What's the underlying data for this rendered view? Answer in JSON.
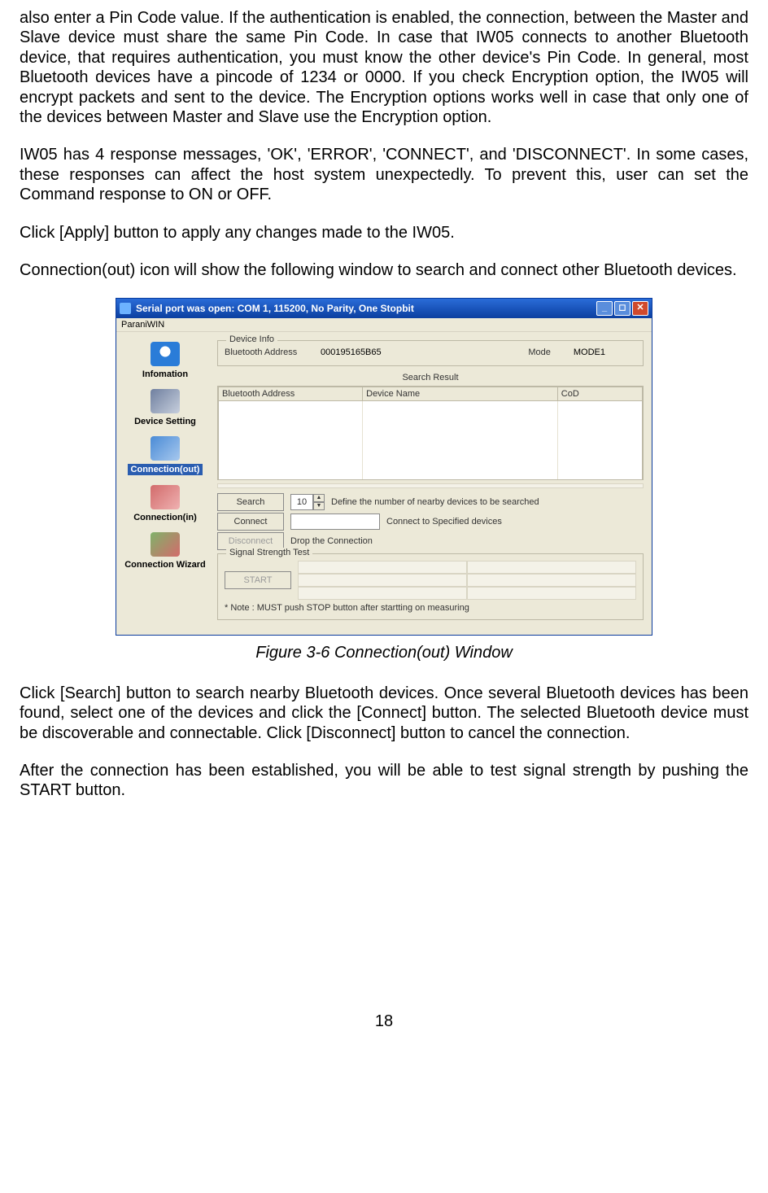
{
  "paragraphs": {
    "p1": "also enter a Pin Code value. If the authentication is enabled, the connection, between the Master and Slave device must share the same Pin Code. In case that IW05 connects to another Bluetooth device, that requires authentication, you must know the other device's Pin Code. In general, most Bluetooth devices have a pincode of 1234 or 0000. If you check Encryption option, the IW05 will encrypt packets and sent to the device. The Encryption options works well in case that only one of the devices between Master and Slave use the Encryption option.",
    "p2": "IW05 has 4 response messages, 'OK', 'ERROR', 'CONNECT', and 'DISCONNECT'. In some cases, these responses can affect the host system unexpectedly. To prevent this, user can set the Command response to ON or OFF.",
    "p3": "Click [Apply] button to apply any changes made to the IW05.",
    "p4": "Connection(out) icon will show the following window to search and connect other Bluetooth devices.",
    "p5": "Click [Search] button to search nearby Bluetooth devices. Once several Bluetooth devices has been found, select one of the devices and click the [Connect] button. The selected Bluetooth device must be discoverable and connectable. Click [Disconnect] button to cancel the connection.",
    "p6": "After the connection has been established, you will be able to test signal strength by pushing the START button."
  },
  "caption": "Figure 3-6 Connection(out) Window",
  "page_number": "18",
  "window": {
    "title": "Serial port was open: COM 1, 115200, No Parity, One Stopbit",
    "menu": "ParaniWIN",
    "sidebar": {
      "information": "Infomation",
      "device_setting": "Device Setting",
      "connection_out": "Connection(out)",
      "connection_in": "Connection(in)",
      "connection_wizard": "Connection Wizard"
    },
    "device_info": {
      "legend": "Device Info",
      "addr_label": "Bluetooth Address",
      "addr_value": "000195165B65",
      "mode_label": "Mode",
      "mode_value": "MODE1"
    },
    "search_result": {
      "title": "Search Result",
      "col_addr": "Bluetooth Address",
      "col_name": "Device Name",
      "col_cod": "CoD"
    },
    "controls": {
      "search_btn": "Search",
      "search_count": "10",
      "search_hint": "Define the number of nearby devices to be searched",
      "connect_btn": "Connect",
      "connect_hint": "Connect to Specified devices",
      "disconnect_btn": "Disconnect",
      "disconnect_hint": "Drop the Connection"
    },
    "signal": {
      "legend": "Signal Strength Test",
      "start_btn": "START",
      "note": "* Note : MUST push STOP button after startting on measuring"
    }
  }
}
